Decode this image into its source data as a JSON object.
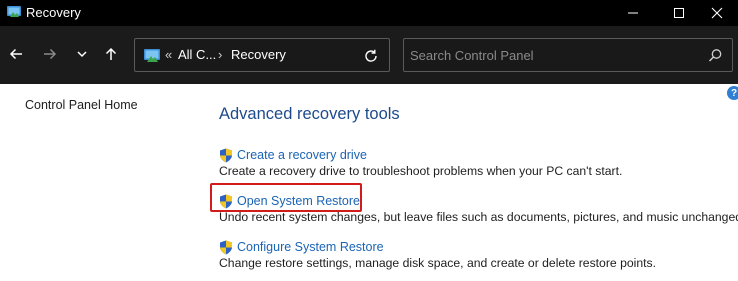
{
  "window": {
    "title": "Recovery"
  },
  "navbar": {
    "breadcrumb": {
      "overflow_marker": "«",
      "items": [
        "All C...",
        "Recovery"
      ],
      "separator": "›"
    },
    "search": {
      "placeholder": "Search Control Panel"
    }
  },
  "sidebar": {
    "home_link": "Control Panel Home"
  },
  "main": {
    "heading": "Advanced recovery tools",
    "tools": [
      {
        "label": "Create a recovery drive",
        "description": "Create a recovery drive to troubleshoot problems when your PC can't start."
      },
      {
        "label": "Open System Restore",
        "description": "Undo recent system changes, but leave files such as documents, pictures, and music unchanged.",
        "highlighted": true
      },
      {
        "label": "Configure System Restore",
        "description": "Change restore settings, manage disk space, and create or delete restore points."
      }
    ],
    "help": "?"
  },
  "colors": {
    "titlebar": "#000000",
    "navbar": "#1b1b1b",
    "heading": "#1d4a8c",
    "link": "#1a64b4",
    "highlight_border": "#d21c1c"
  },
  "icons": {
    "app": "control-panel-icon",
    "tool": "uac-shield-icon"
  }
}
